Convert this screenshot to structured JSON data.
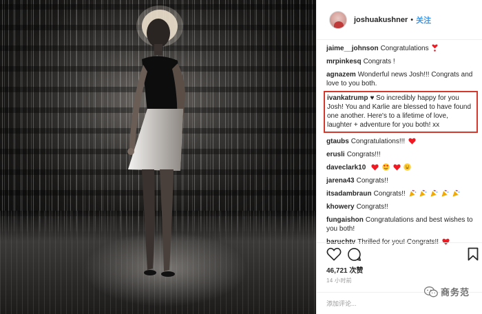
{
  "header": {
    "username": "joshuakushner",
    "separator": "•",
    "follow_label": "关注"
  },
  "comments": [
    {
      "user": "jaime__johnson",
      "text": "Congratulations",
      "emoji": [
        "heart-exclamation"
      ]
    },
    {
      "user": "mrpinkesq",
      "text": "Congrats !",
      "emoji": []
    },
    {
      "user": "agnazem",
      "text": "Wonderful news Josh!!! Congrats and love to you both.",
      "emoji": []
    },
    {
      "user": "ivankatrump",
      "text": "♥ So incredibly happy for you Josh! You and Karlie are blessed to have found one another. Here's to a lifetime of love, laughter + adventure for you both! xx",
      "emoji": [],
      "highlighted": true
    },
    {
      "user": "gtaubs",
      "text": "Congratulations!!!",
      "emoji": [
        "red-heart"
      ]
    },
    {
      "user": "erusli",
      "text": "Congrats!!!",
      "emoji": []
    },
    {
      "user": "daveclark10",
      "text": "",
      "emoji": [
        "red-heart",
        "smile-heart-eyes",
        "red-heart",
        "grinning-face"
      ]
    },
    {
      "user": "jarena43",
      "text": "Congrats!!",
      "emoji": []
    },
    {
      "user": "itsadambraun",
      "text": "Congrats!!",
      "emoji": [
        "party-popper",
        "party-popper",
        "party-popper",
        "party-popper",
        "party-popper"
      ]
    },
    {
      "user": "khowery",
      "text": "Congrats!!",
      "emoji": []
    },
    {
      "user": "fungaishon",
      "text": "Congratulations and best wishes to you both!",
      "emoji": []
    },
    {
      "user": "baruchtv",
      "text": "Thrilled for you! Congrats!!",
      "emoji": [
        "red-heart"
      ]
    }
  ],
  "actions": {
    "like_icon": "heart-outline-icon",
    "comment_icon": "comment-bubble-icon",
    "save_icon": "bookmark-icon"
  },
  "likes_text": "46,721 次赞",
  "time_text": "14 小时前",
  "add_comment_placeholder": "添加评论...",
  "watermark_text": "商务范",
  "colors": {
    "follow_blue": "#3897f0",
    "highlight_red": "#d4382c",
    "heart_red": "#ed1c24",
    "muted_text": "#999999"
  }
}
